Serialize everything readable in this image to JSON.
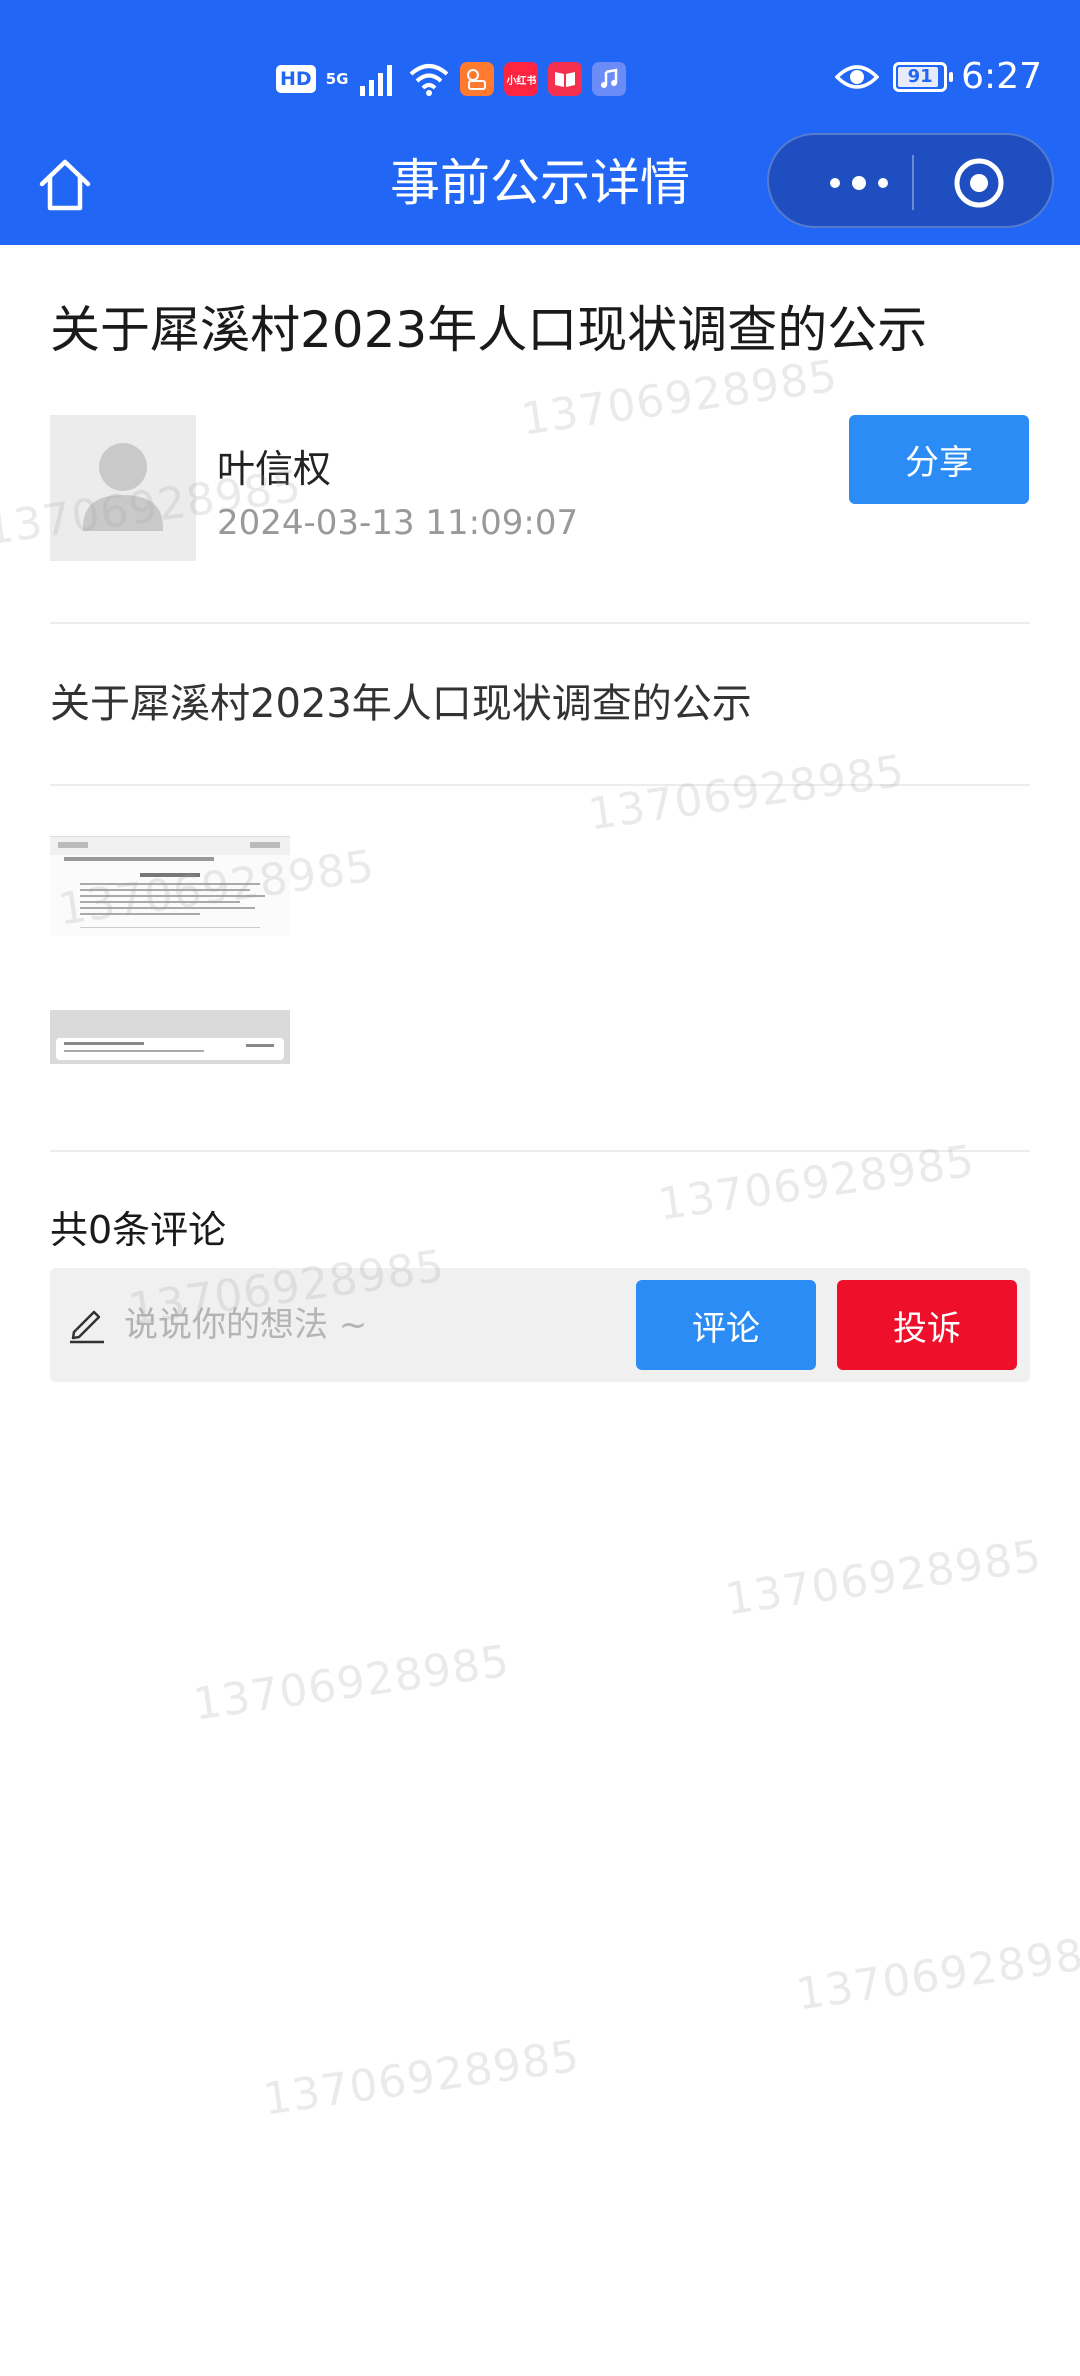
{
  "status_bar": {
    "hd": "HD",
    "network": "5G",
    "network_sub": "1l",
    "apps": [
      "小红书"
    ],
    "battery": "91",
    "battery_level": 0.91,
    "time": "6:27"
  },
  "nav": {
    "title": "事前公示详情"
  },
  "article": {
    "title": "关于犀溪村2023年人口现状调查的公示",
    "author": "叶信权",
    "time": "2024-03-13 11:09:07",
    "share_label": "分享",
    "body": "关于犀溪村2023年人口现状调查的公示"
  },
  "comments": {
    "count_label": "共0条评论",
    "input_placeholder": "说说你的想法 ~",
    "comment_label": "评论",
    "report_label": "投诉"
  },
  "watermark": "13706928985",
  "colors": {
    "header_blue": "#2266f6",
    "button_blue": "#2a8cf4",
    "report_red": "#ee0f2a"
  }
}
